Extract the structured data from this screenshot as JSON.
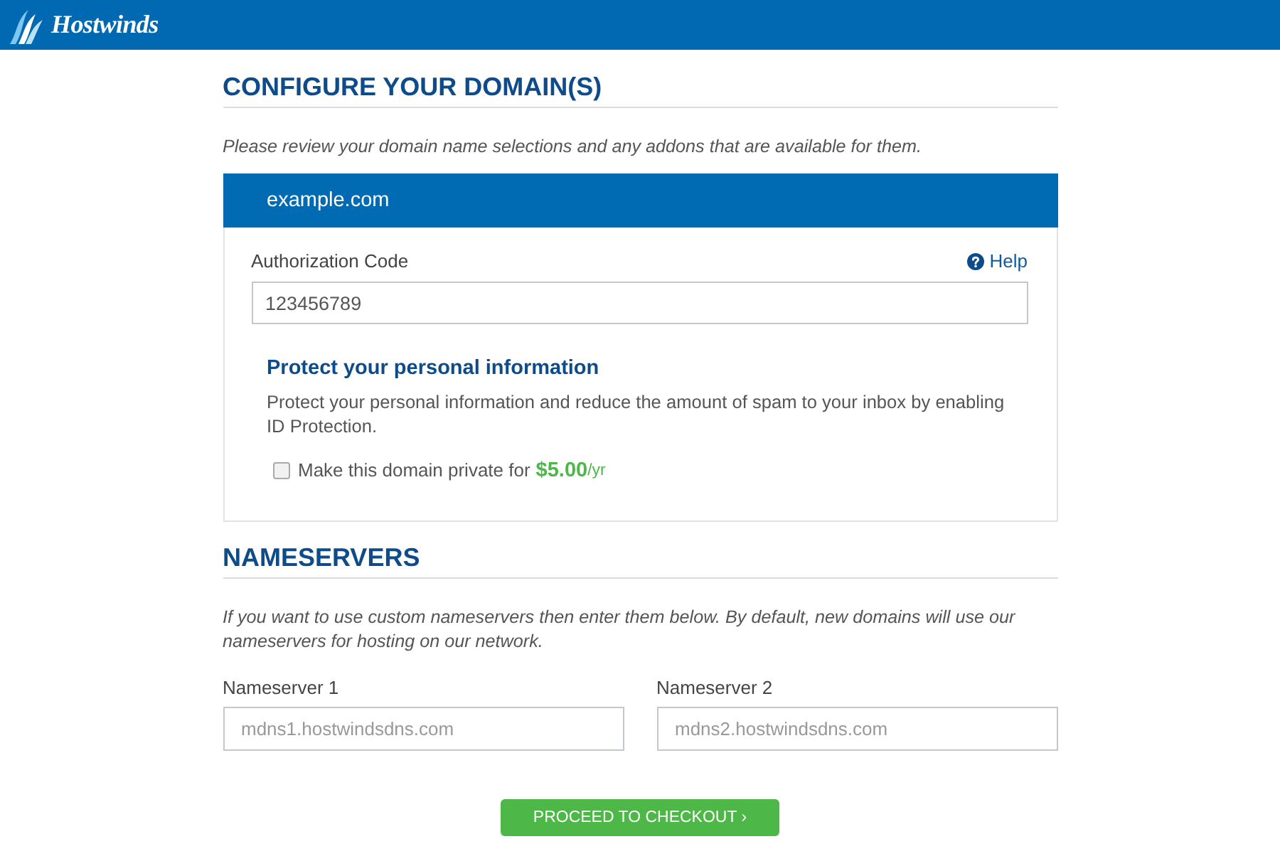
{
  "header": {
    "logo": "Hostwinds"
  },
  "configure": {
    "title": "CONFIGURE YOUR DOMAIN(S)",
    "intro": "Please review your domain name selections and any addons that are available for them.",
    "domain": {
      "name": "example.com",
      "auth_label": "Authorization Code",
      "help": "Help",
      "auth_value": "123456789",
      "protect_title": "Protect your personal information",
      "protect_text": "Protect your personal information and reduce the amount of spam to your inbox by enabling ID Protection.",
      "privacy": {
        "label": "Make this domain private for",
        "price": "$5.00",
        "period": "/yr",
        "checked": false
      }
    }
  },
  "nameservers": {
    "title": "NAMESERVERS",
    "intro": "If you want to use custom nameservers then enter them below. By default, new domains will use our nameservers for hosting on our network.",
    "fields": [
      {
        "label": "Nameserver 1",
        "placeholder": "mdns1.hostwindsdns.com"
      },
      {
        "label": "Nameserver 2",
        "placeholder": "mdns2.hostwindsdns.com"
      }
    ]
  },
  "checkout_button": "PROCEED TO CHECKOUT ›"
}
